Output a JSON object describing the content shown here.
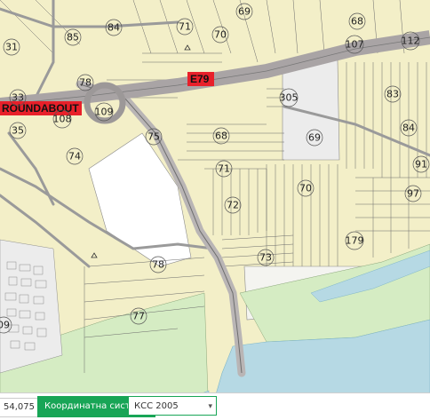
{
  "map": {
    "road_labels": {
      "e79": "E79",
      "roundabout": "ROUNDABOUT"
    },
    "parcels": [
      "69",
      "68",
      "31",
      "85",
      "84",
      "71",
      "70",
      "107",
      "112",
      "78",
      "33",
      "109",
      "305",
      "83",
      "108",
      "35",
      "75",
      "68",
      "69",
      "84",
      "74",
      "71",
      "91",
      "70",
      "97",
      "72",
      "179",
      "73",
      "78",
      "77",
      "09"
    ]
  },
  "bottom_bar": {
    "scale_value": "54,075",
    "coordinate_system_label": "Координатна система",
    "coordinate_system_value": "КСС 2005"
  },
  "colors": {
    "land": "#f3efc8",
    "river": "#b6d9e4",
    "floodplain": "#d5ecc3",
    "road": "#b9b5b5",
    "highway": "#a9a4a5",
    "parcel_line": "#5f5f5f",
    "label_box": "#e8202a",
    "accent_green": "#18a556"
  }
}
